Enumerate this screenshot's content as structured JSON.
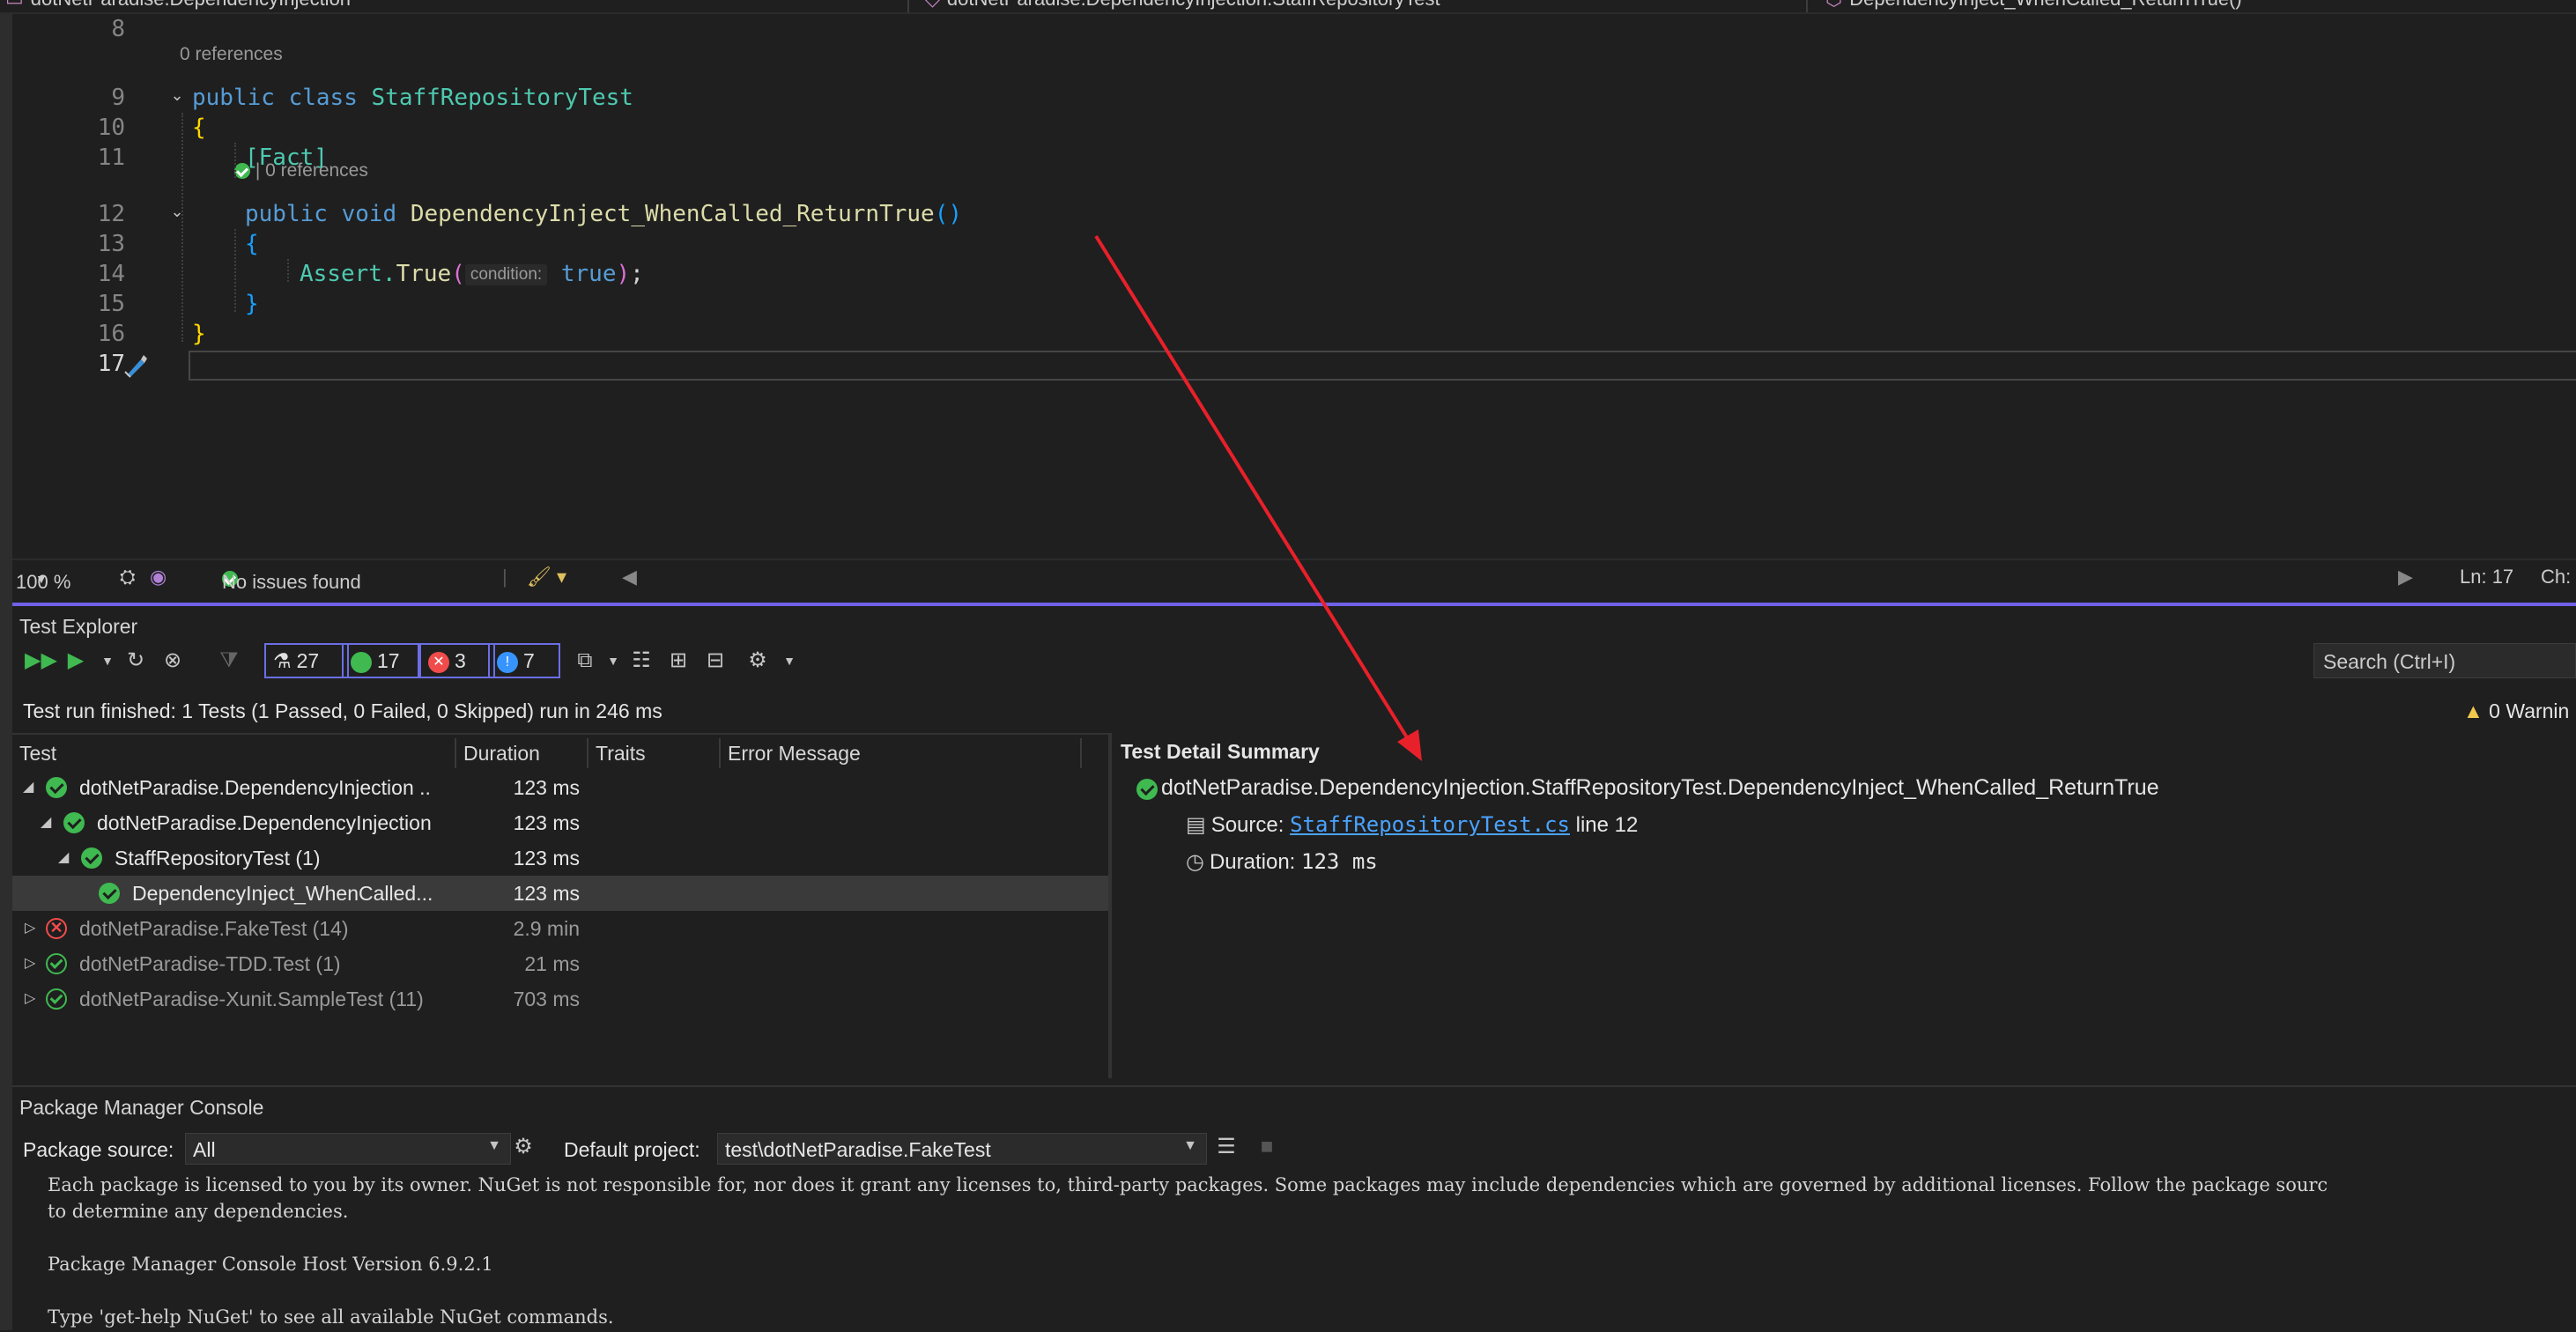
{
  "tabs": [
    {
      "label": "dotNetParadise.DependencyInjection"
    },
    {
      "label": "dotNetParadise.DependencyInjection.StaffRepositoryTest"
    },
    {
      "label": "DependencyInject_WhenCalled_ReturnTrue()"
    }
  ],
  "editor": {
    "line_numbers": [
      "8",
      "9",
      "10",
      "11",
      "12",
      "13",
      "14",
      "15",
      "16",
      "17"
    ],
    "lens_class": "0 references",
    "lens_method": "| 0 references",
    "code": {
      "l9_public": "public",
      "l9_class": "class",
      "l9_name": "StaffRepositoryTest",
      "l10": "{",
      "l11": "[Fact]",
      "l12_public": "public",
      "l12_void": "void",
      "l12_name": "DependencyInject_WhenCalled_ReturnTrue",
      "l12_parens": "()",
      "l13": "{",
      "l14_assert": "Assert.",
      "l14_true_fn": "True",
      "l14_open": "(",
      "l14_hint": "condition:",
      "l14_val": "true",
      "l14_close": ");",
      "l15": "}",
      "l16": "}"
    }
  },
  "editor_status": {
    "zoom": "100 %",
    "issues": "No issues found",
    "position_ln": "Ln: 17",
    "position_ch": "Ch:"
  },
  "test_explorer": {
    "title": "Test Explorer",
    "counters": {
      "total": "27",
      "passed": "17",
      "failed": "3",
      "not_run": "7"
    },
    "search_placeholder": "Search (Ctrl+I)",
    "run_message": "Test run finished: 1 Tests (1 Passed, 0 Failed, 0 Skipped) run in 246 ms",
    "warnings": "0 Warnin",
    "columns": [
      "Test",
      "Duration",
      "Traits",
      "Error Message"
    ],
    "rows": [
      {
        "name": "dotNetParadise.DependencyInjection ..",
        "duration": "123 ms",
        "status": "passed"
      },
      {
        "name": "dotNetParadise.DependencyInjection",
        "duration": "123 ms",
        "status": "passed"
      },
      {
        "name": "StaffRepositoryTest  (1)",
        "duration": "123 ms",
        "status": "passed"
      },
      {
        "name": "DependencyInject_WhenCalled...",
        "duration": "123 ms",
        "status": "passed",
        "selected": true
      },
      {
        "name": "dotNetParadise.FakeTest  (14)",
        "duration": "2.9 min",
        "status": "failed"
      },
      {
        "name": "dotNetParadise-TDD.Test  (1)",
        "duration": "21 ms",
        "status": "passed"
      },
      {
        "name": "dotNetParadise-Xunit.SampleTest  (11)",
        "duration": "703 ms",
        "status": "passed"
      }
    ],
    "detail": {
      "title": "Test Detail Summary",
      "full_name": "dotNetParadise.DependencyInjection.StaffRepositoryTest.DependencyInject_WhenCalled_ReturnTrue",
      "source_label": "Source:",
      "source_file": "StaffRepositoryTest.cs",
      "source_line": "line 12",
      "duration_label": "Duration:",
      "duration_value": "123 ms"
    }
  },
  "package_manager_console": {
    "title": "Package Manager Console",
    "package_source_label": "Package source:",
    "package_source_value": "All",
    "default_project_label": "Default project:",
    "default_project_value": "test\\dotNetParadise.FakeTest",
    "output": [
      "Each package is licensed to you by its owner. NuGet is not responsible for, nor does it grant any licenses to, third-party packages. Some packages may include dependencies which are governed by additional licenses. Follow the package sourc",
      "to determine any dependencies.",
      "",
      "Package Manager Console Host Version 6.9.2.1",
      "",
      "Type 'get-help NuGet' to see all available NuGet commands."
    ]
  },
  "colors": {
    "accent": "#7160e8",
    "pass": "#3fb950",
    "fail": "#f14c4c",
    "annotation_arrow": "#e8202a"
  }
}
